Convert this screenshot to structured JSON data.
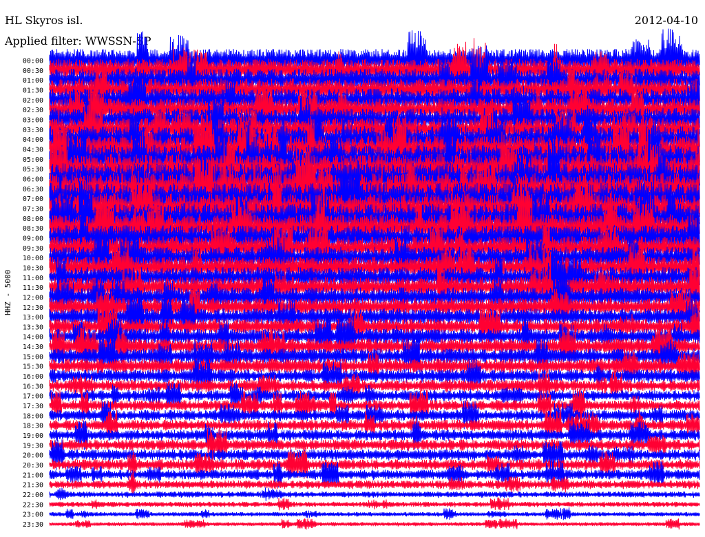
{
  "header": {
    "station": "HL Skyros isl.",
    "date": "2012-04-10",
    "filter": "Applied filter: WWSSN-SP"
  },
  "side_label": "HHZ - 5000",
  "chart_data": {
    "type": "line",
    "title": "",
    "xlabel": "",
    "ylabel": "HHZ - 5000",
    "trace_colors": [
      "#0000ff",
      "#ff0033"
    ],
    "row_labels": [
      "00:00",
      "00:30",
      "01:00",
      "01:30",
      "02:00",
      "02:30",
      "03:00",
      "03:30",
      "04:00",
      "04:30",
      "05:00",
      "05:30",
      "06:00",
      "06:30",
      "07:00",
      "07:30",
      "08:00",
      "08:30",
      "09:00",
      "09:30",
      "10:00",
      "10:30",
      "11:00",
      "11:30",
      "12:00",
      "12:30",
      "13:00",
      "13:30",
      "14:00",
      "14:30",
      "15:00",
      "15:30",
      "16:00",
      "16:30",
      "17:00",
      "17:30",
      "18:00",
      "18:30",
      "19:00",
      "19:30",
      "20:00",
      "20:30",
      "21:00",
      "21:30",
      "22:00",
      "22:30",
      "23:00",
      "23:30"
    ],
    "relative_amplitude": [
      1.0,
      1.0,
      1.0,
      1.0,
      1.0,
      1.0,
      1.0,
      1.0,
      1.15,
      1.2,
      1.25,
      1.3,
      1.35,
      1.35,
      1.35,
      1.3,
      1.3,
      1.2,
      1.1,
      1.0,
      0.95,
      0.95,
      0.9,
      0.9,
      0.85,
      0.8,
      0.75,
      0.7,
      0.7,
      0.7,
      0.7,
      0.68,
      0.6,
      0.55,
      0.5,
      0.5,
      0.5,
      0.5,
      0.5,
      0.5,
      0.5,
      0.5,
      0.45,
      0.38,
      0.28,
      0.24,
      0.2,
      0.18
    ]
  }
}
